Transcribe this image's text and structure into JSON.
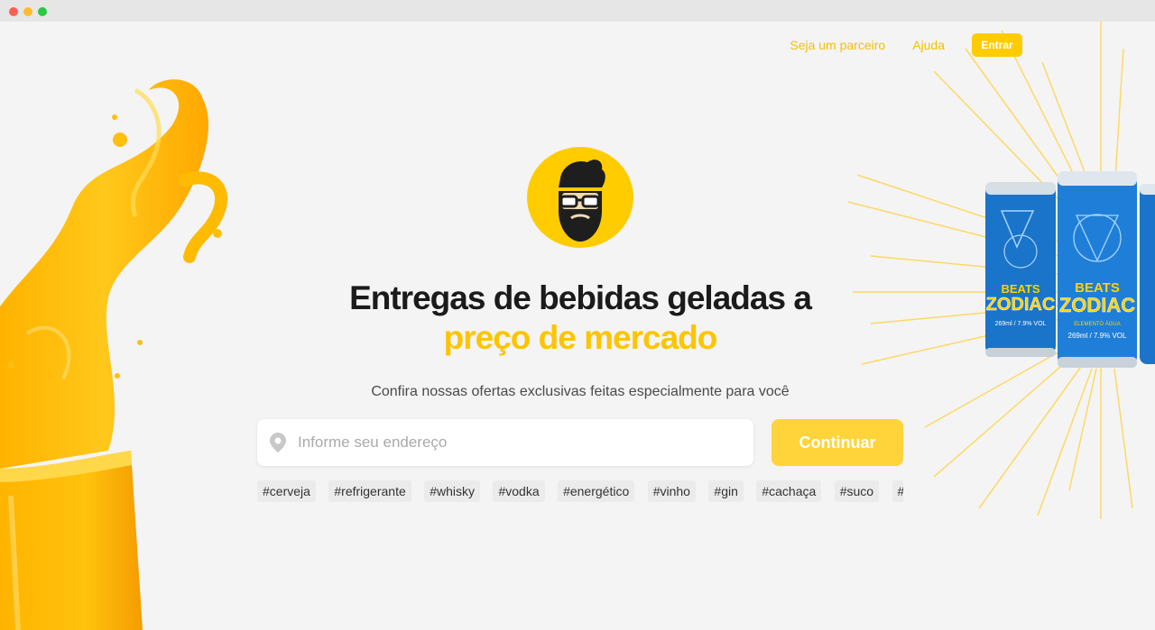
{
  "window": {
    "controls": [
      "close",
      "minimize",
      "maximize"
    ]
  },
  "nav": {
    "partner_link": "Seja um parceiro",
    "help_link": "Ajuda",
    "login_button": "Entrar"
  },
  "hero": {
    "headline_line1": "Entregas de bebidas geladas a",
    "headline_line2": "preço de mercado",
    "subtitle": "Confira nossas ofertas exclusivas feitas especialmente para você",
    "address_placeholder": "Informe seu endereço",
    "continue_button": "Continuar"
  },
  "tags": [
    "#cerveja",
    "#refrigerante",
    "#whisky",
    "#vodka",
    "#energético",
    "#vinho",
    "#gin",
    "#cachaça",
    "#suco",
    "#água"
  ],
  "product": {
    "brand_top": "BEATS",
    "brand_main": "ZODIAC",
    "flavor": "ELEMENTO ÁGUA",
    "volume": "269ml / 7.9% VOL"
  },
  "icons": {
    "logo": "bearded-man-logo-icon",
    "pin": "location-pin-icon"
  },
  "colors": {
    "brand_yellow": "#ffcc00",
    "accent_text": "#ffc400",
    "can_blue": "#1a74c9",
    "background": "#f4f4f4"
  }
}
